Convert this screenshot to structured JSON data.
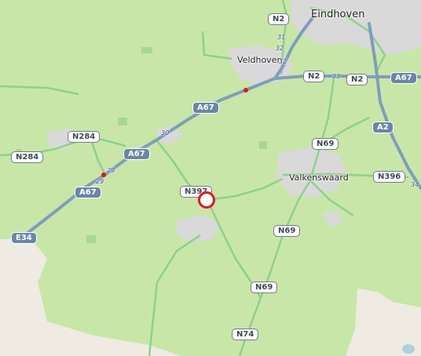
{
  "colors": {
    "farmland": "#c8e6a8",
    "urban": "#d6d6d6",
    "motorway": "#7f9dbd",
    "primary_road": "#8fd08a",
    "water": "#aad3df",
    "marker": "#e8141a"
  },
  "places": {
    "eindhoven": "Eindhoven",
    "veldhoven": "Veldhoven",
    "valkenswaard": "Valkenswaard"
  },
  "shields": {
    "n2_top": "N2",
    "n2_mid": "N2",
    "n2_right": "N2",
    "a67_right": "A67",
    "a67_center": "A67",
    "a67_left": "A67",
    "a67_bottom": "A67",
    "a2": "A2",
    "n284_top": "N284",
    "n284_left": "N284",
    "e34": "E34",
    "n397": "N397",
    "n69_top": "N69",
    "n69_mid": "N69",
    "n69_low": "N69",
    "n396": "N396",
    "n74": "N74"
  },
  "junctions": {
    "j31": "31",
    "j32a": "32",
    "j32b": "32",
    "j33": "33",
    "j30": "30",
    "j29a": "29",
    "j29b": "29",
    "j34": "34"
  },
  "marker": {
    "icon": "location-marker-icon"
  }
}
